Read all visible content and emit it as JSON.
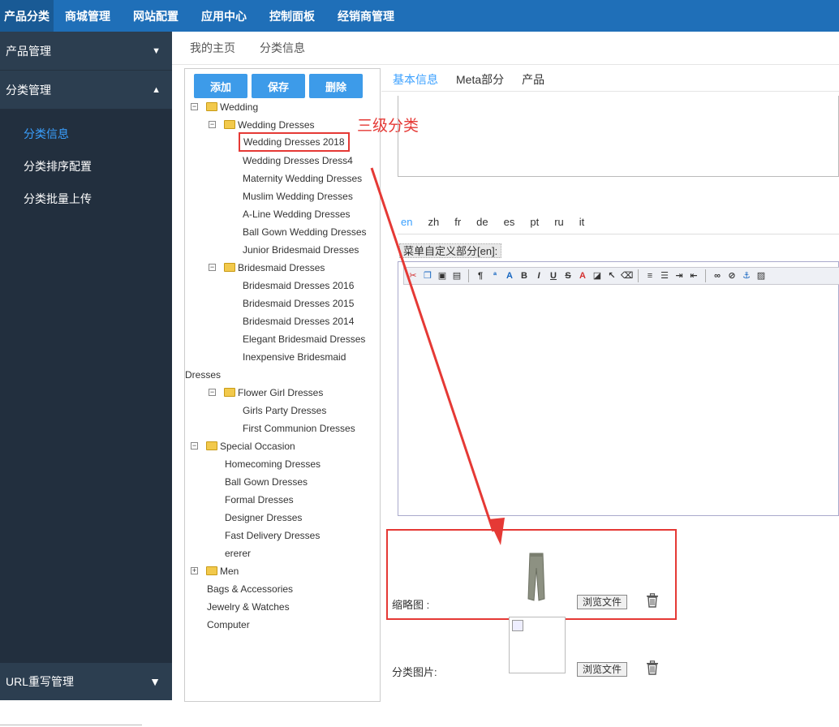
{
  "topbar": {
    "tabs": [
      "产品分类",
      "商城管理",
      "网站配置",
      "应用中心",
      "控制面板",
      "经销商管理"
    ],
    "active": 0
  },
  "sidebar": {
    "groups": [
      {
        "label": "产品管理",
        "caret": "▼"
      },
      {
        "label": "分类管理",
        "caret": "▲"
      }
    ],
    "items": [
      "分类信息",
      "分类排序配置",
      "分类批量上传"
    ],
    "active_item": 0,
    "bottom": {
      "label": "URL重写管理",
      "caret": "▼"
    }
  },
  "breadcrumb": [
    "我的主页",
    "分类信息"
  ],
  "tree_buttons": {
    "add": "添加",
    "save": "保存",
    "delete": "删除"
  },
  "tree": {
    "wedding": "Wedding",
    "wedding_dresses": "Wedding Dresses",
    "wd": [
      "Wedding Dresses 2018",
      "Wedding Dresses Dress4",
      "Maternity Wedding Dresses",
      "Muslim Wedding Dresses",
      "A-Line Wedding Dresses",
      "Ball Gown Wedding Dresses",
      "Junior Bridesmaid Dresses"
    ],
    "bridesmaid": "Bridesmaid Dresses",
    "bd": [
      "Bridesmaid Dresses 2016",
      "Bridesmaid Dresses 2015",
      "Bridesmaid Dresses 2014",
      "Elegant Bridesmaid Dresses",
      "Inexpensive Bridesmaid"
    ],
    "bd_wrap": "Dresses",
    "flower": "Flower Girl Dresses",
    "fg": [
      "Girls Party Dresses",
      "First Communion Dresses"
    ],
    "special": "Special Occasion",
    "so": [
      "Homecoming Dresses",
      "Ball Gown Dresses",
      "Formal Dresses",
      "Designer Dresses",
      "Fast Delivery Dresses",
      "ererer"
    ],
    "men": "Men",
    "roots": [
      "Bags & Accessories",
      "Jewelry & Watches",
      "Computer"
    ]
  },
  "annotation": "三级分类",
  "main_tabs": [
    "基本信息",
    "Meta部分",
    "产品"
  ],
  "main_tab_active": 0,
  "languages": [
    "en",
    "zh",
    "fr",
    "de",
    "es",
    "pt",
    "ru",
    "it"
  ],
  "language_active": 0,
  "editor_legend": "菜单自定义部分[en]:",
  "thumbnail_label": "缩略图 :",
  "category_image_label": "分类图片:",
  "browse_label": "浏览文件",
  "colors": {
    "topbar": "#1f6fb8",
    "accent": "#3aa0ff",
    "annotation": "#e53935"
  }
}
